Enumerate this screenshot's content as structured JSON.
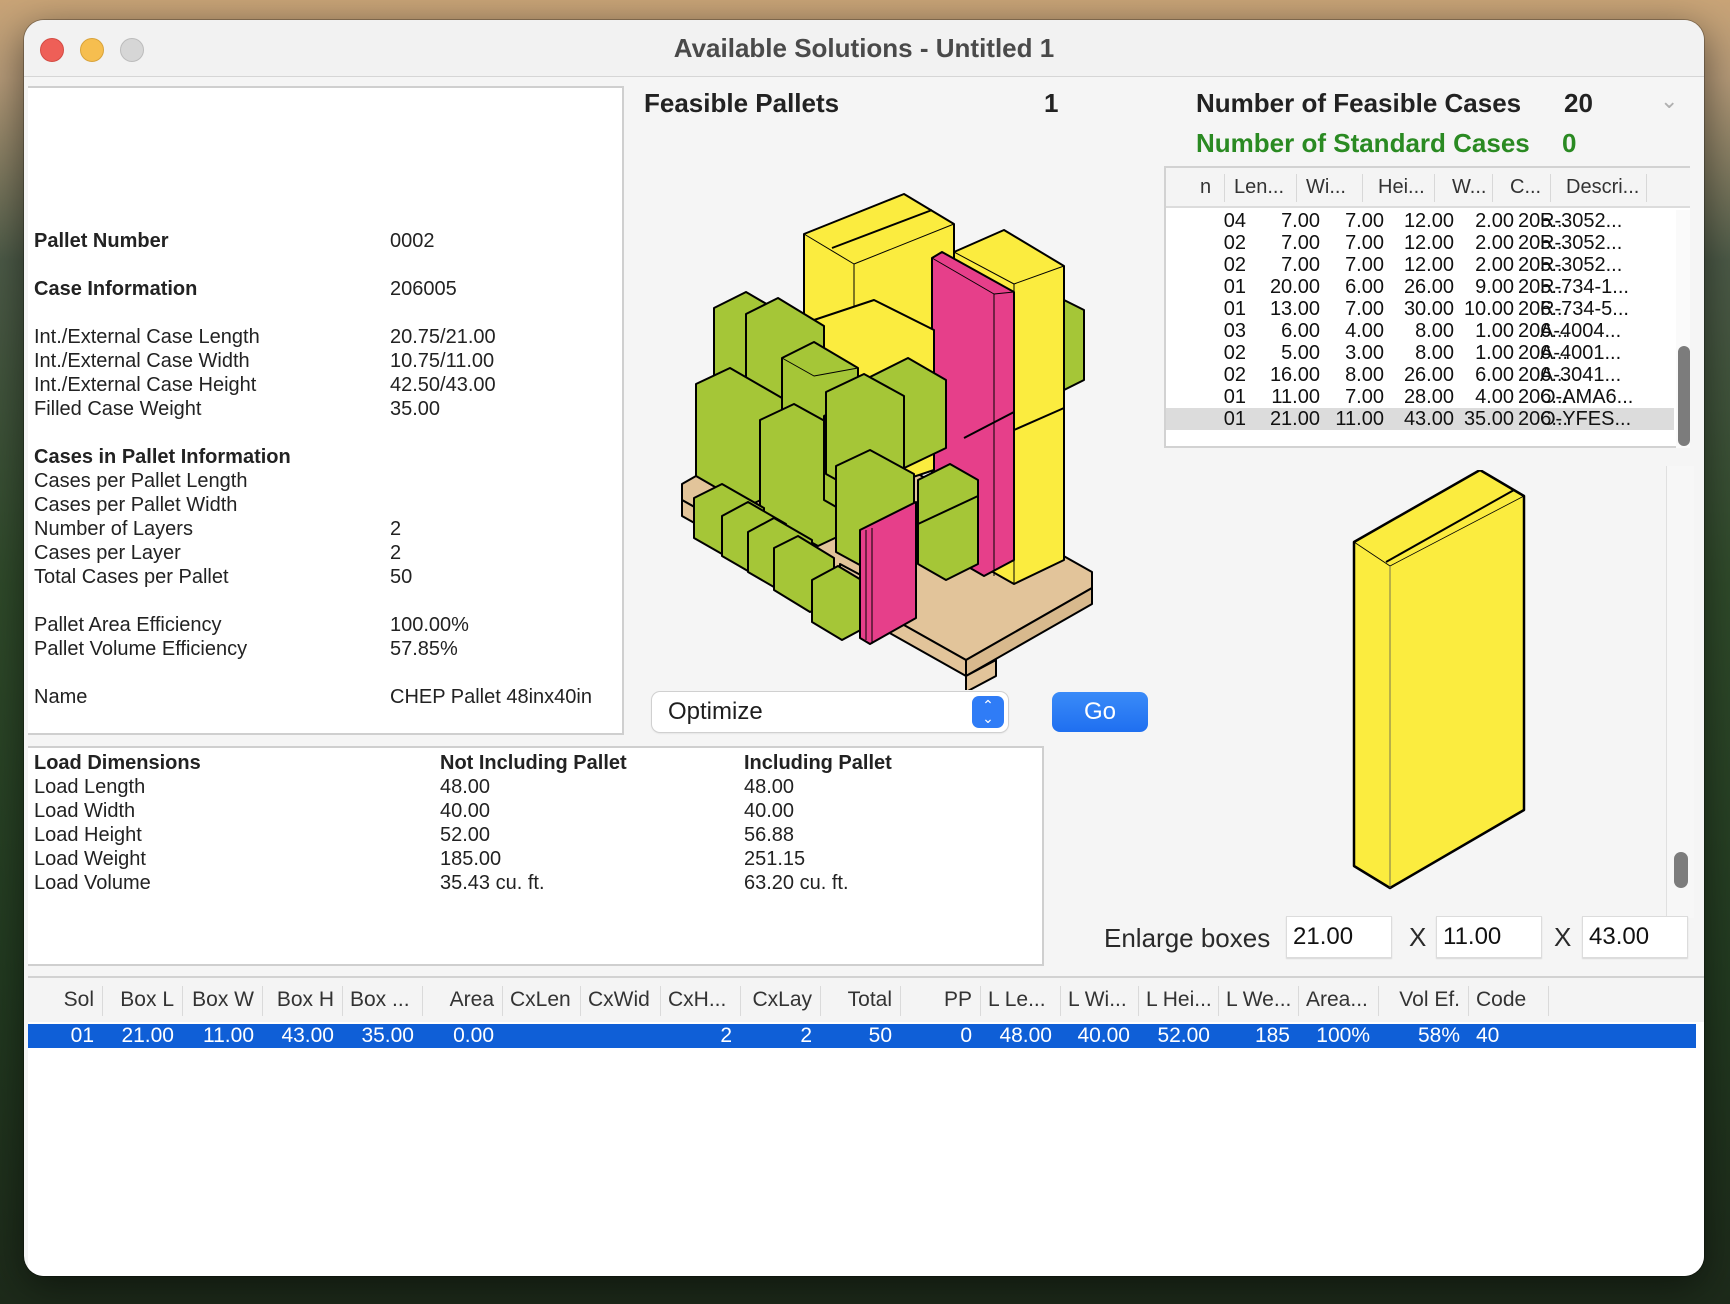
{
  "window": {
    "title": "Available Solutions - Untitled 1"
  },
  "info": {
    "pallet_number_label": "Pallet Number",
    "pallet_number": "0002",
    "case_info_label": "Case Information",
    "case_info": "206005",
    "rows": [
      {
        "label": "Int./External Case Length",
        "value": "20.75/21.00"
      },
      {
        "label": "Int./External Case Width",
        "value": "10.75/11.00"
      },
      {
        "label": "Int./External Case Height",
        "value": "42.50/43.00"
      },
      {
        "label": "Filled Case Weight",
        "value": "35.00"
      }
    ],
    "cases_in_pallet_label": "Cases in Pallet Information",
    "pallet_rows": [
      {
        "label": "Cases per Pallet Length",
        "value": ""
      },
      {
        "label": "Cases per Pallet Width",
        "value": ""
      },
      {
        "label": "Number of Layers",
        "value": "2"
      },
      {
        "label": "Cases per Layer",
        "value": "2"
      },
      {
        "label": "Total Cases per Pallet",
        "value": "50"
      }
    ],
    "eff_rows": [
      {
        "label": "Pallet Area Efficiency",
        "value": "100.00%"
      },
      {
        "label": "Pallet Volume Efficiency",
        "value": "57.85%"
      }
    ],
    "name_label": "Name",
    "name": "CHEP Pallet 48inx40in"
  },
  "load": {
    "headers": [
      "Load Dimensions",
      "Not Including Pallet",
      "Including Pallet"
    ],
    "rows": [
      [
        "Load Length",
        "48.00",
        "48.00"
      ],
      [
        "Load Width",
        "40.00",
        "40.00"
      ],
      [
        "Load Height",
        "52.00",
        "56.88"
      ],
      [
        "Load Weight",
        "185.00",
        "251.15"
      ],
      [
        "Load Volume",
        "35.43 cu. ft.",
        "63.20 cu. ft."
      ]
    ]
  },
  "stats": {
    "feasible_pallets_label": "Feasible Pallets",
    "feasible_pallets": "1",
    "feasible_cases_label": "Number of Feasible Cases",
    "feasible_cases": "20",
    "standard_cases_label": "Number of Standard Cases",
    "standard_cases": "0",
    "standard_color": "#2a8a22"
  },
  "cases_table": {
    "headers": [
      "n",
      "Len...",
      "Wi...",
      "Hei...",
      "W...",
      "C...",
      "Descri..."
    ],
    "rows": [
      [
        "04",
        "7.00",
        "7.00",
        "12.00",
        "2.00",
        "205...",
        "R-3052..."
      ],
      [
        "02",
        "7.00",
        "7.00",
        "12.00",
        "2.00",
        "205...",
        "R-3052..."
      ],
      [
        "02",
        "7.00",
        "7.00",
        "12.00",
        "2.00",
        "205...",
        "R-3052..."
      ],
      [
        "01",
        "20.00",
        "6.00",
        "26.00",
        "9.00",
        "205...",
        "R-734-1..."
      ],
      [
        "01",
        "13.00",
        "7.00",
        "30.00",
        "10.00",
        "206...",
        "R-734-5..."
      ],
      [
        "03",
        "6.00",
        "4.00",
        "8.00",
        "1.00",
        "206...",
        "A-4004..."
      ],
      [
        "02",
        "5.00",
        "3.00",
        "8.00",
        "1.00",
        "206...",
        "A-4001..."
      ],
      [
        "02",
        "16.00",
        "8.00",
        "26.00",
        "6.00",
        "206...",
        "A-3041..."
      ],
      [
        "01",
        "11.00",
        "7.00",
        "28.00",
        "4.00",
        "206...",
        "O-AMA6..."
      ],
      [
        "01",
        "21.00",
        "11.00",
        "43.00",
        "35.00",
        "206...",
        "O-YFES..."
      ]
    ],
    "selected_index": 9
  },
  "controls": {
    "mode_select": "Optimize",
    "go_label": "Go",
    "enlarge_label": "Enlarge boxes",
    "enlarge_l": "21.00",
    "enlarge_w": "11.00",
    "enlarge_h": "43.00",
    "times": "X"
  },
  "colors": {
    "case_green": "#a5c637",
    "case_yellow": "#fbec3f",
    "case_pink": "#e63f8a",
    "pallet_wood": "#e2c49a",
    "selection_blue": "#0f5fd7",
    "accent_blue": "#2f7cf6"
  },
  "results": {
    "headers": [
      "Sol",
      "Box L",
      "Box W",
      "Box H",
      "Box ...",
      "Area",
      "CxLen",
      "CxWid",
      "CxH...",
      "CxLay",
      "Total",
      "PP",
      "L Le...",
      "L Wi...",
      "L Hei...",
      "L We...",
      "Area...",
      "Vol Ef.",
      "Code"
    ],
    "rows": [
      [
        "01",
        "21.00",
        "11.00",
        "43.00",
        "35.00",
        "0.00",
        "",
        "",
        "2",
        "2",
        "50",
        "0",
        "48.00",
        "40.00",
        "52.00",
        "185",
        "100%",
        "58%",
        "40"
      ]
    ]
  }
}
